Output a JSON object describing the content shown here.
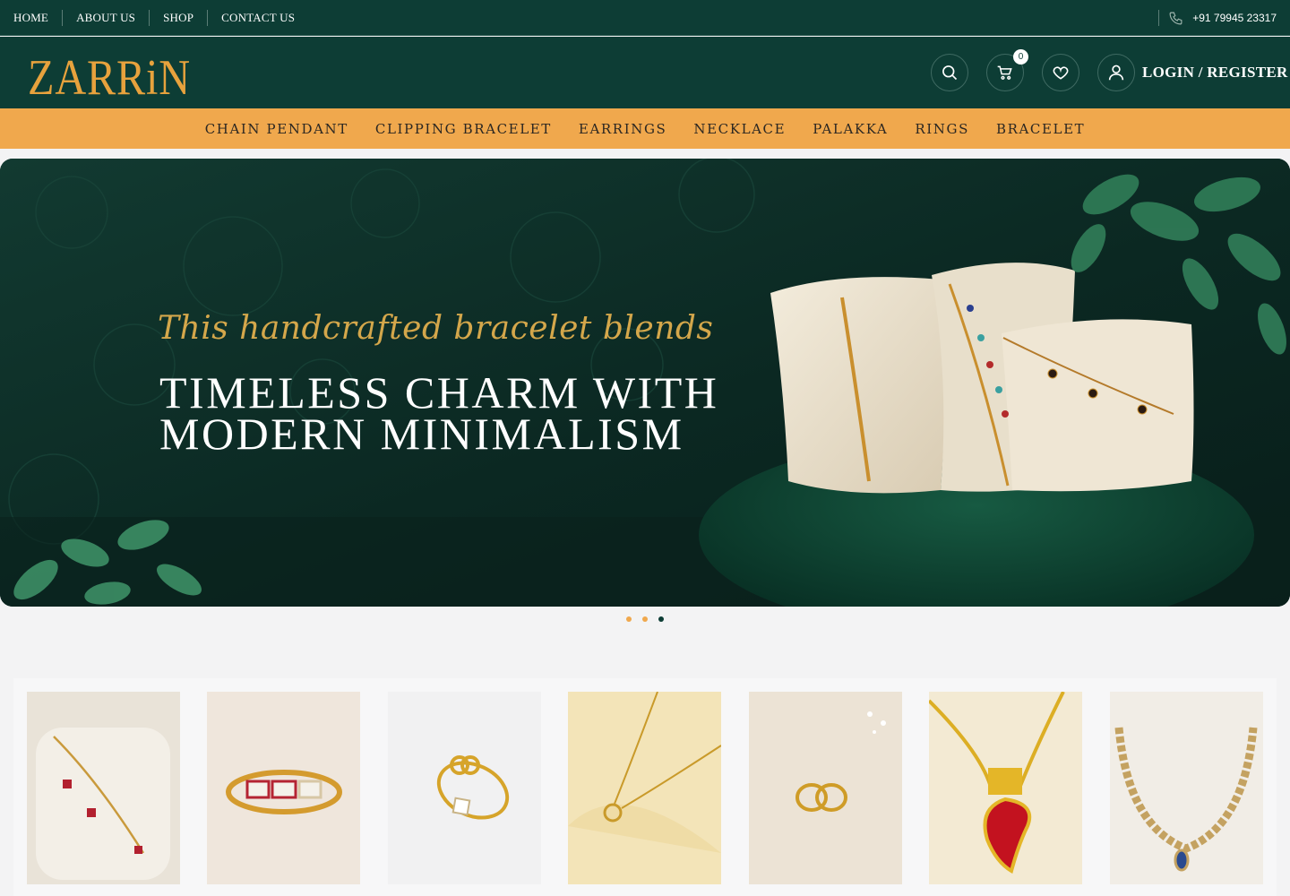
{
  "topnav": {
    "home": "HOME",
    "about": "ABOUT US",
    "shop": "SHOP",
    "contact": "CONTACT US"
  },
  "phone": "+91 79945 23317",
  "brand": {
    "name": "ZARRiN",
    "gold": "#e7a23d"
  },
  "header": {
    "cart_count": "0",
    "login_label": "LOGIN / REGISTER"
  },
  "categories": [
    "CHAIN PENDANT",
    "CLIPPING BRACELET",
    "EARRINGS",
    "NECKLACE",
    "PALAKKA",
    "RINGS",
    "BRACELET"
  ],
  "hero": {
    "script": "This handcrafted bracelet blends",
    "line1": "TIMELESS CHARM WITH",
    "line2": "MODERN MINIMALISM"
  },
  "carousel": {
    "slides": 3,
    "active": 3
  },
  "colors": {
    "dark_green": "#0d3d35",
    "accent_orange": "#f0a84d",
    "gold": "#d4a74b"
  },
  "products": [
    {
      "icon": "bracelet-with-red-stones"
    },
    {
      "icon": "rectangle-link-bangle"
    },
    {
      "icon": "knot-ring"
    },
    {
      "icon": "circle-pendant-chain"
    },
    {
      "icon": "hoop-earrings"
    },
    {
      "icon": "palakka-necklace"
    },
    {
      "icon": "stone-necklace"
    }
  ]
}
